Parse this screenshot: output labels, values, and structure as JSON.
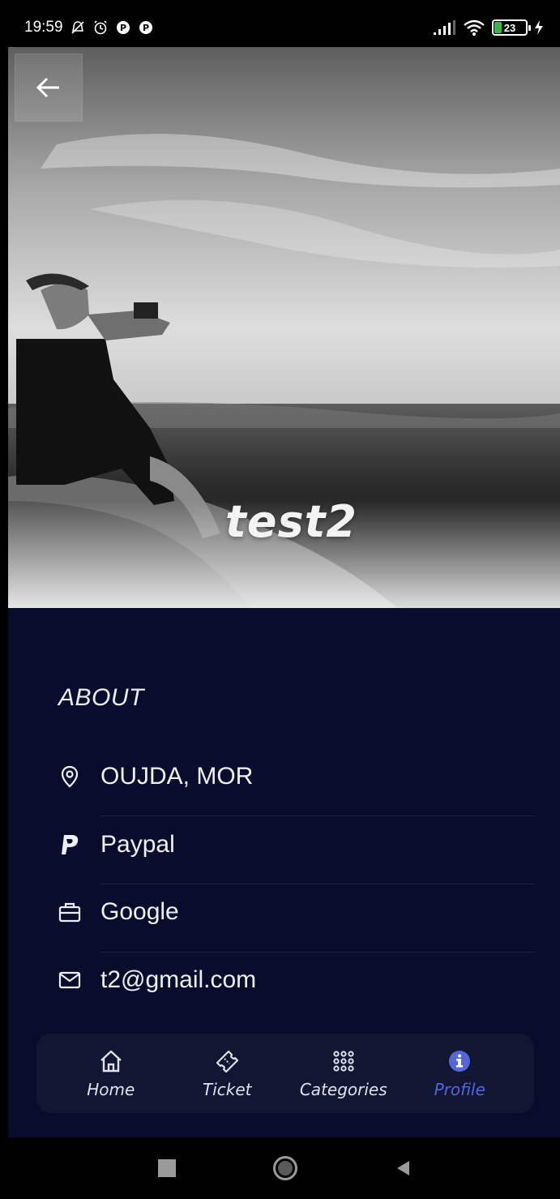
{
  "status_bar": {
    "time": "19:59",
    "battery": "23",
    "icons": [
      "mute-icon",
      "alarm-icon",
      "app-icon",
      "app-icon",
      "signal-icon",
      "wifi-icon",
      "battery-icon",
      "charging-icon"
    ]
  },
  "header": {
    "back_icon": "arrow-left-icon",
    "title": "test2"
  },
  "about": {
    "heading": "ABOUT",
    "items": [
      {
        "icon": "location-pin-icon",
        "text": "OUJDA, MOR"
      },
      {
        "icon": "paypal-icon",
        "text": "Paypal"
      },
      {
        "icon": "briefcase-icon",
        "text": "Google"
      },
      {
        "icon": "envelope-icon",
        "text": "t2@gmail.com"
      }
    ]
  },
  "bottom_nav": {
    "active": "Profile",
    "items": [
      {
        "icon": "home-icon",
        "label": "Home"
      },
      {
        "icon": "ticket-icon",
        "label": "Ticket"
      },
      {
        "icon": "grid-icon",
        "label": "Categories"
      },
      {
        "icon": "info-icon",
        "label": "Profile"
      }
    ]
  },
  "colors": {
    "background": "#080d2b",
    "nav_background": "#111733",
    "accent": "#5566d6",
    "text": "#eef0f8"
  }
}
